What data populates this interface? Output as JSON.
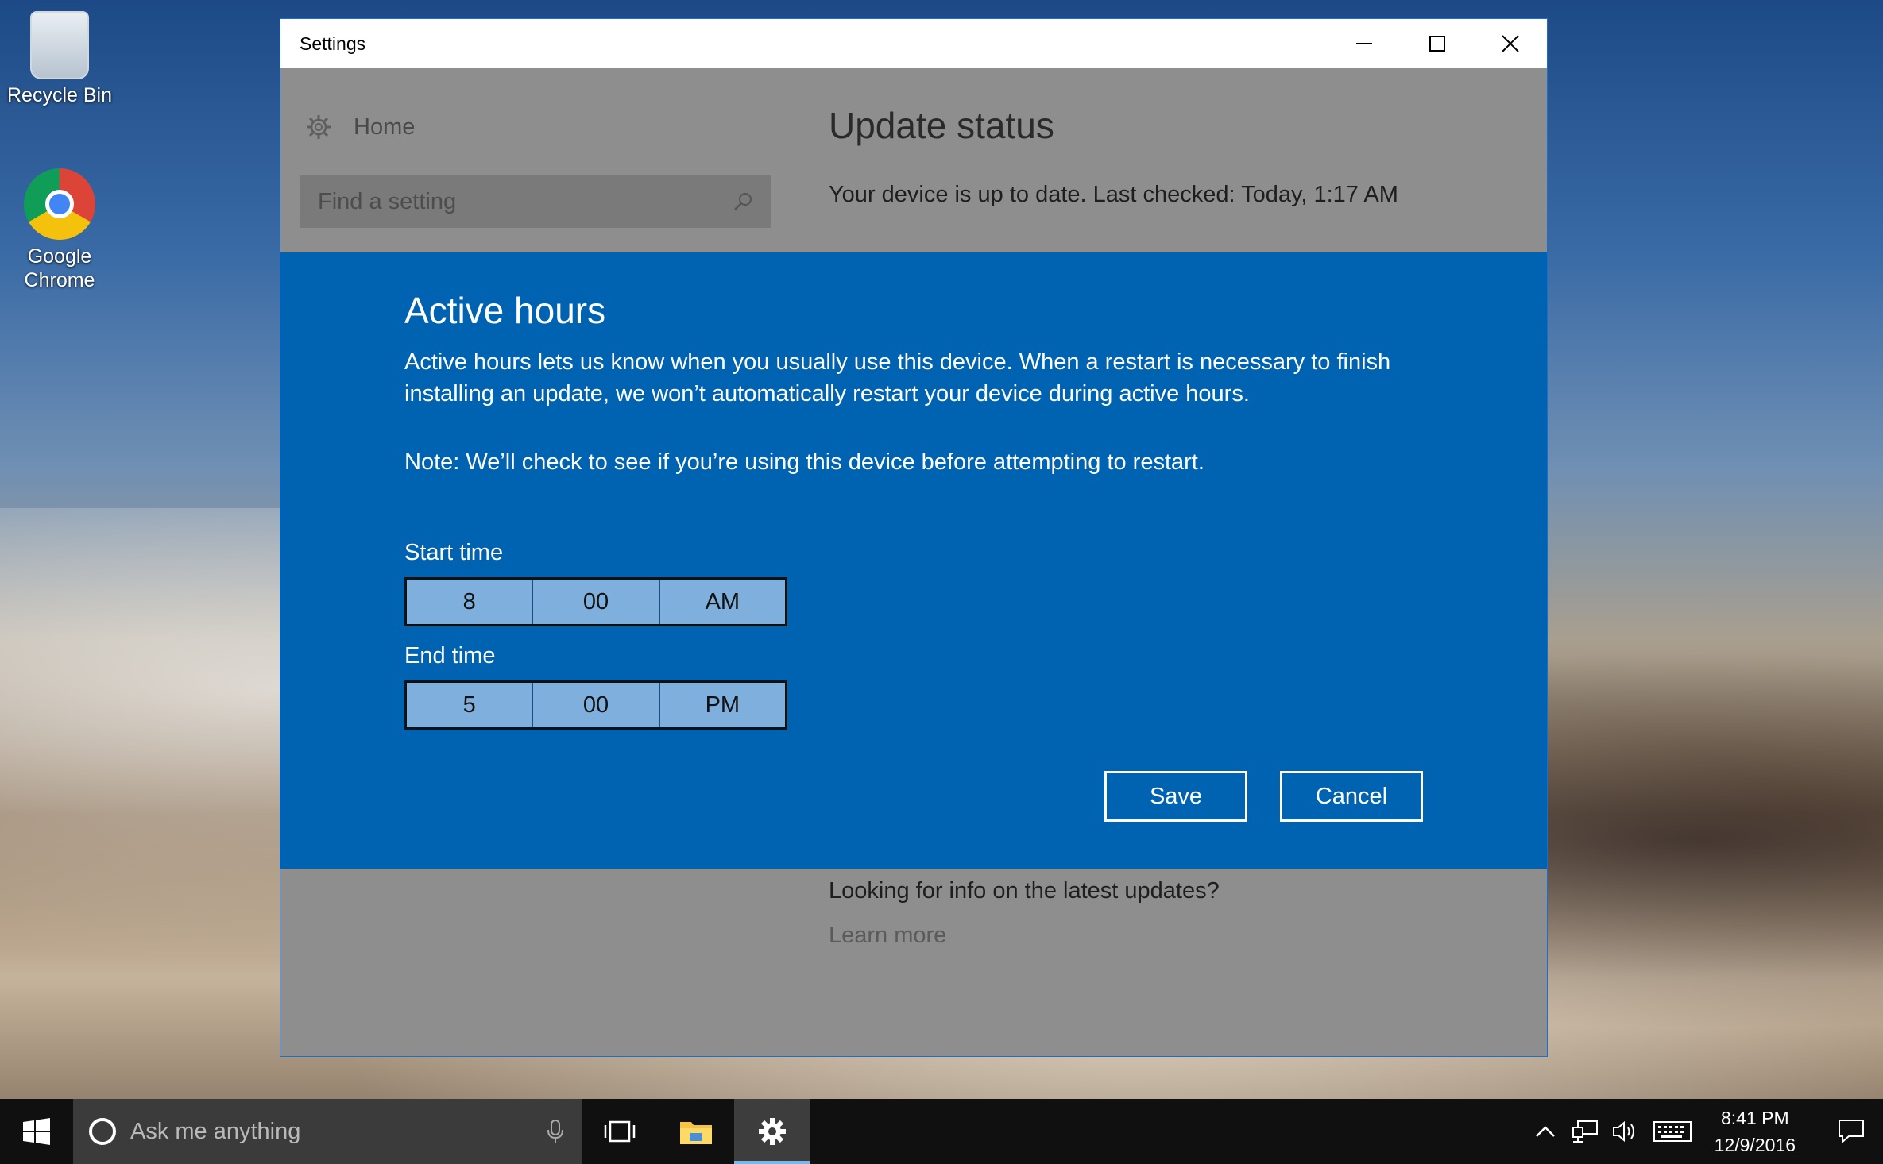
{
  "desktop": {
    "icons": [
      {
        "label": "Recycle Bin"
      },
      {
        "label": "Google\nChrome"
      }
    ]
  },
  "window": {
    "title": "Settings",
    "nav": {
      "home_label": "Home",
      "search_placeholder": "Find a setting"
    },
    "update": {
      "title": "Update status",
      "status": "Your device is up to date. Last checked: Today, 1:17 AM"
    },
    "active_hours": {
      "title": "Active hours",
      "description": "Active hours lets us know when you usually use this device. When a restart is necessary to finish installing an update, we won’t automatically restart your device during active hours.",
      "note": "Note: We’ll check to see if you’re using this device before attempting to restart.",
      "start": {
        "label": "Start time",
        "hour": "8",
        "minute": "00",
        "period": "AM"
      },
      "end": {
        "label": "End time",
        "hour": "5",
        "minute": "00",
        "period": "PM"
      },
      "save_label": "Save",
      "cancel_label": "Cancel"
    },
    "footer": {
      "looking": "Looking for info on the latest updates?",
      "learn_more": "Learn more"
    }
  },
  "taskbar": {
    "search_placeholder": "Ask me anything",
    "time": "8:41 PM",
    "date": "12/9/2016"
  },
  "colors": {
    "dialog_bg": "#0063b1",
    "dim_bg": "#8e8e8f",
    "taskbar_bg": "#101010",
    "accent": "#76b9ed"
  }
}
